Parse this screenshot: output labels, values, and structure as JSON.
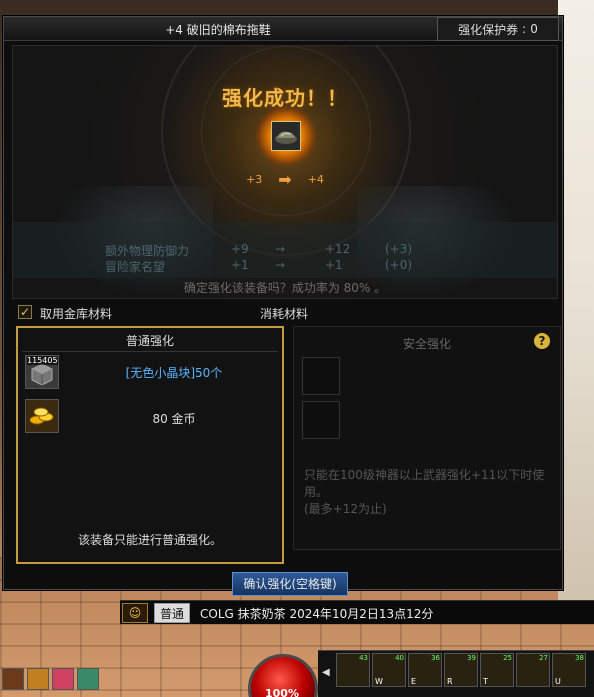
{
  "dialog": {
    "title": "+4 破旧的棉布拖鞋",
    "protect_ticket_label": "强化保护券",
    "protect_ticket_sep": ":",
    "protect_ticket_count": "0",
    "success_text": "强化成功！！",
    "level_from": "+3",
    "level_to": "+4",
    "stats": [
      {
        "name": "额外物理防御力",
        "before": "+9",
        "after": "+12",
        "delta": "(+3)"
      },
      {
        "name": "冒险家名望",
        "before": "+1",
        "after": "+1",
        "delta": "(+0)"
      }
    ],
    "confirm_question": "确定强化该装备吗？成功率为 80% 。"
  },
  "materials": {
    "use_storage_label": "取用金库材料",
    "use_storage_checked": true,
    "consume_label": "消耗材料",
    "normal": {
      "title": "普通强化",
      "item1_count": "115405",
      "item1_label": "[无色小晶块]50个",
      "item2_label": "80 金币",
      "note": "该装备只能进行普通强化。"
    },
    "safe": {
      "title": "安全强化",
      "help": "?",
      "note": "只能在100级神器以上武器强化+11以下时使用。\n(最多+12为止)"
    }
  },
  "confirm_button": "确认强化(空格键)",
  "chat": {
    "mode": "普通",
    "input_value": "COLG 抹茶奶茶 2024年10月2日13点12分"
  },
  "hud": {
    "hp_percent": "100%",
    "skills": [
      {
        "lv": "43",
        "key": ""
      },
      {
        "lv": "40",
        "key": "W"
      },
      {
        "lv": "36",
        "key": "E"
      },
      {
        "lv": "39",
        "key": "R"
      },
      {
        "lv": "25",
        "key": "T"
      },
      {
        "lv": "27",
        "key": ""
      },
      {
        "lv": "38",
        "key": "U"
      }
    ]
  },
  "colors": {
    "accent_gold": "#c99a3b",
    "success_orange": "#f2b94a",
    "material_blue": "#5ab4ff",
    "confirm_blue": "#2e5a9a"
  }
}
